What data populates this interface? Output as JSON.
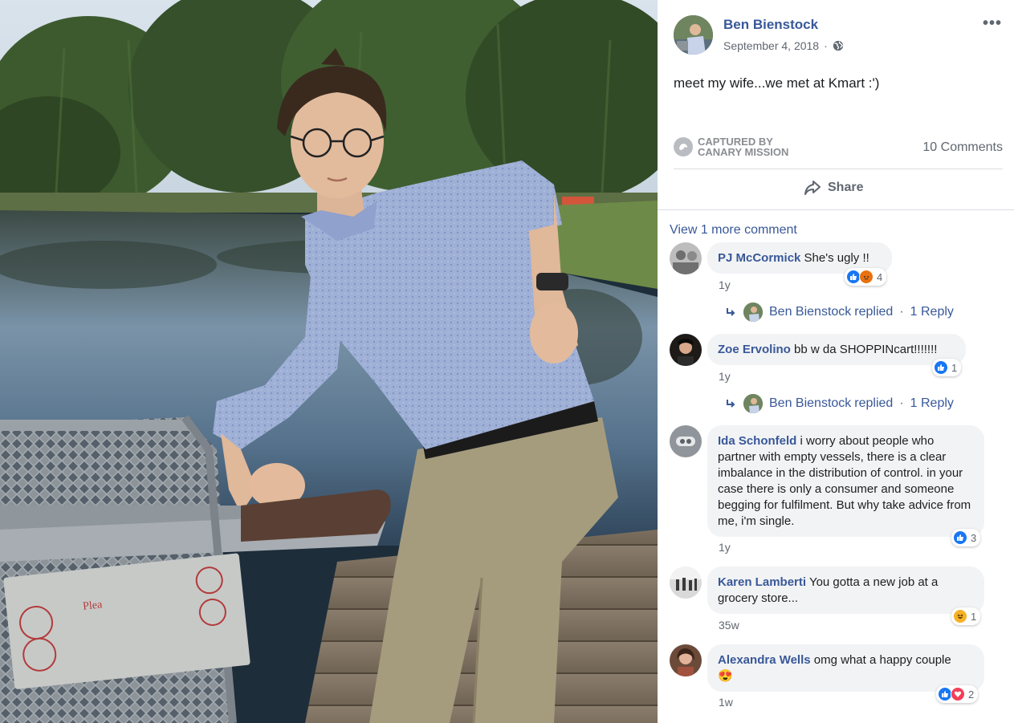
{
  "post": {
    "author": "Ben Bienstock",
    "date": "September 4, 2018",
    "date_separator": "·",
    "privacy_icon": "globe-icon",
    "text": "meet my wife...we met at Kmart :')",
    "more_label": "•••",
    "watermark_line1": "Captured by",
    "watermark_line2": "Canary Mission",
    "comment_count": "10 Comments",
    "share_label": "Share"
  },
  "comments_section": {
    "view_more": "View 1 more comment",
    "comments": [
      {
        "name": "PJ McCormick",
        "text": "She's ugly !!",
        "time": "1y",
        "reaction_count": "4",
        "reactions": [
          "like",
          "angry"
        ],
        "reply": {
          "author": "Ben Bienstock",
          "action": "replied",
          "sep": "·",
          "count": "1 Reply"
        }
      },
      {
        "name": "Zoe Ervolino",
        "text": "bb w da SHOPPINcart!!!!!!!",
        "time": "1y",
        "reaction_count": "1",
        "reactions": [
          "like"
        ],
        "reply": {
          "author": "Ben Bienstock",
          "action": "replied",
          "sep": "·",
          "count": "1 Reply"
        }
      },
      {
        "name": "Ida Schonfeld",
        "text": "i worry about people who partner with empty vessels, there is a clear imbalance in the distribution of control. in your case there is only a consumer and someone begging for fulfilment. But why take advice from me, i'm single.",
        "time": "1y",
        "reaction_count": "3",
        "reactions": [
          "like"
        ]
      },
      {
        "name": "Karen Lamberti",
        "text": "You gotta a new job at a grocery store...",
        "time": "35w",
        "reaction_count": "1",
        "reactions": [
          "haha"
        ]
      },
      {
        "name": "Alexandra Wells",
        "text": "omg what a happy couple",
        "emoji": "😍",
        "time": "1w",
        "reaction_count": "2",
        "reactions": [
          "like",
          "love"
        ]
      }
    ]
  },
  "colors": {
    "link": "#385898",
    "like": "#1877f2",
    "angry": "#e9710f",
    "haha": "#f7b125",
    "love": "#f33e58"
  }
}
